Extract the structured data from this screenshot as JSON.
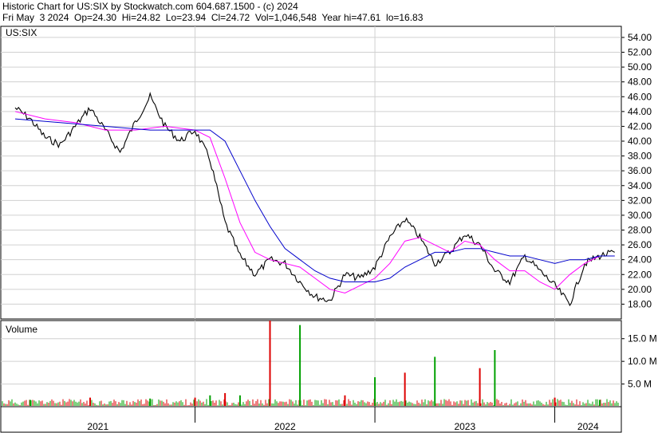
{
  "header": {
    "line1": "Historic Chart for US:SIX by Stockwatch.com 604.687.1500 - (c) 2024",
    "line2": "Fri May  3 2024  Op=24.30  Hi=24.82  Lo=23.94  Cl=24.72  Vol=1,046,548  Year hi=47.61  lo=16.83"
  },
  "chart_data": [
    {
      "type": "line",
      "title": "US:SIX",
      "ylim": [
        16.0,
        55.5
      ],
      "y_ticks": [
        "18.00",
        "20.00",
        "22.00",
        "24.00",
        "26.00",
        "28.00",
        "30.00",
        "32.00",
        "34.00",
        "36.00",
        "38.00",
        "40.00",
        "42.00",
        "44.00",
        "46.00",
        "48.00",
        "50.00",
        "52.00",
        "54.00"
      ],
      "x_ticks": [
        "2021",
        "2022",
        "2023",
        "2024"
      ],
      "grid": true,
      "series": [
        {
          "name": "",
          "x": [
            "2021-01",
            "2021-02",
            "2021-03",
            "2021-04",
            "2021-05",
            "2021-06",
            "2021-07",
            "2021-08",
            "2021-09",
            "2021-10",
            "2021-11",
            "2021-12",
            "2022-01",
            "2022-02",
            "2022-03",
            "2022-04",
            "2022-05",
            "2022-06",
            "2022-07",
            "2022-08",
            "2022-09",
            "2022-10",
            "2022-11",
            "2022-12",
            "2023-01",
            "2023-02",
            "2023-03",
            "2023-04",
            "2023-05",
            "2023-06",
            "2023-07",
            "2023-08",
            "2023-09",
            "2023-10",
            "2023-11",
            "2023-12",
            "2024-01",
            "2024-02",
            "2024-03",
            "2024-04",
            "2024-05"
          ],
          "values": [
            44.5,
            43.0,
            40.5,
            39.5,
            42.0,
            44.5,
            41.5,
            38.5,
            42.5,
            46.0,
            42.0,
            40.0,
            41.5,
            37.5,
            29.0,
            24.5,
            22.0,
            24.0,
            23.5,
            21.0,
            19.0,
            18.5,
            22.0,
            21.5,
            23.0,
            27.0,
            29.5,
            27.0,
            23.5,
            25.0,
            27.5,
            26.0,
            22.5,
            21.0,
            24.5,
            22.5,
            20.5,
            18.0,
            23.5,
            24.5,
            25.0
          ],
          "color": "#000000"
        },
        {
          "name": "",
          "x": [
            "2021-01",
            "2021-03",
            "2021-05",
            "2021-07",
            "2021-09",
            "2021-11",
            "2022-01",
            "2022-02",
            "2022-03",
            "2022-04",
            "2022-05",
            "2022-06",
            "2022-07",
            "2022-08",
            "2022-09",
            "2022-10",
            "2022-11",
            "2022-12",
            "2023-01",
            "2023-02",
            "2023-03",
            "2023-04",
            "2023-05",
            "2023-06",
            "2023-07",
            "2023-08",
            "2023-09",
            "2023-10",
            "2023-11",
            "2023-12",
            "2024-01",
            "2024-02",
            "2024-03",
            "2024-04",
            "2024-05"
          ],
          "values": [
            44.0,
            43.0,
            42.5,
            41.5,
            41.5,
            42.0,
            41.5,
            40.5,
            35.0,
            29.0,
            25.0,
            24.0,
            23.5,
            23.0,
            21.5,
            20.0,
            19.5,
            20.5,
            21.5,
            23.5,
            26.5,
            27.0,
            26.0,
            25.0,
            26.5,
            26.0,
            24.0,
            22.5,
            22.5,
            21.0,
            20.0,
            22.0,
            23.5,
            24.5,
            24.5
          ],
          "color": "#ff00ff"
        },
        {
          "name": "",
          "x": [
            "2021-01",
            "2021-04",
            "2021-07",
            "2021-10",
            "2022-01",
            "2022-02",
            "2022-03",
            "2022-04",
            "2022-05",
            "2022-06",
            "2022-07",
            "2022-08",
            "2022-09",
            "2022-10",
            "2022-11",
            "2022-12",
            "2023-01",
            "2023-02",
            "2023-03",
            "2023-04",
            "2023-05",
            "2023-06",
            "2023-07",
            "2023-08",
            "2023-09",
            "2023-10",
            "2023-11",
            "2023-12",
            "2024-01",
            "2024-02",
            "2024-03",
            "2024-04",
            "2024-05"
          ],
          "values": [
            43.0,
            42.5,
            42.0,
            41.5,
            41.5,
            41.5,
            40.0,
            36.0,
            32.0,
            28.5,
            25.5,
            24.0,
            22.5,
            21.5,
            21.0,
            21.0,
            21.0,
            21.5,
            23.0,
            24.0,
            25.0,
            25.0,
            25.5,
            25.5,
            25.0,
            24.5,
            24.5,
            24.0,
            23.5,
            24.0,
            24.0,
            24.5,
            24.5
          ],
          "color": "#0000cc"
        }
      ]
    },
    {
      "type": "bar",
      "title": "Volume",
      "ylim": [
        0,
        19
      ],
      "y_ticks": [
        "5.0 M",
        "10.0 M",
        "15.0 M"
      ],
      "x": [
        "2021-02",
        "2021-06",
        "2021-10",
        "2022-01",
        "2022-02",
        "2022-03",
        "2022-04",
        "2022-06",
        "2022-08",
        "2022-11",
        "2023-01",
        "2023-03",
        "2023-05",
        "2023-08",
        "2023-09",
        "2024-01",
        "2024-04"
      ],
      "values": [
        1.5,
        2.0,
        1.8,
        2.0,
        2.5,
        3.0,
        2.5,
        19.0,
        18.0,
        2.5,
        6.5,
        7.5,
        11.0,
        8.5,
        12.5,
        2.0,
        1.5
      ],
      "colors": {
        "up": "#00a000",
        "down": "#dd0000"
      }
    }
  ]
}
